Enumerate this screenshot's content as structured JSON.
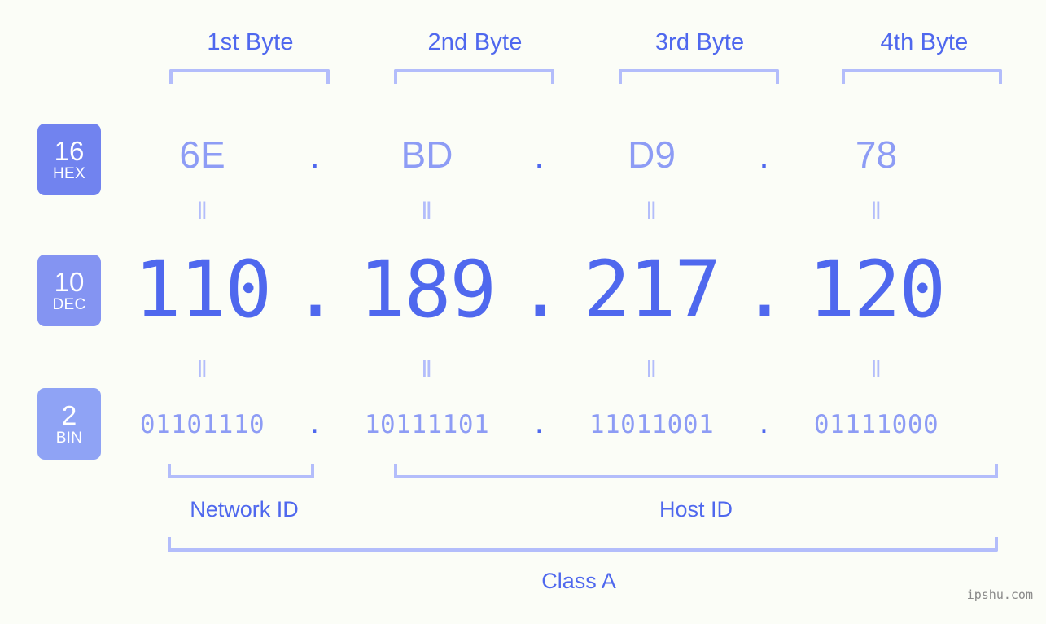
{
  "background_color": "#fbfdf7",
  "accent_color": "#4f68ee",
  "accent_light_color": "#8d9cf5",
  "bracket_color": "#b3bdfb",
  "byte_headers": [
    {
      "label": "1st Byte"
    },
    {
      "label": "2nd Byte"
    },
    {
      "label": "3rd Byte"
    },
    {
      "label": "4th Byte"
    }
  ],
  "bases": {
    "hex": {
      "number": "16",
      "abbr": "HEX",
      "color": "#7183ef"
    },
    "dec": {
      "number": "10",
      "abbr": "DEC",
      "color": "#8494f2"
    },
    "bin": {
      "number": "2",
      "abbr": "BIN",
      "color": "#8fa3f5"
    }
  },
  "rows": {
    "hex": {
      "values": [
        "6E",
        "BD",
        "D9",
        "78"
      ],
      "separator": "."
    },
    "dec": {
      "values": [
        "110",
        "189",
        "217",
        "120"
      ],
      "separator": "."
    },
    "bin": {
      "values": [
        "01101110",
        "10111101",
        "11011001",
        "01111000"
      ],
      "separator": "."
    }
  },
  "equality_mark": "‖",
  "sections": {
    "network_id": "Network ID",
    "host_id": "Host ID",
    "class": "Class A"
  },
  "watermark": "ipshu.com"
}
